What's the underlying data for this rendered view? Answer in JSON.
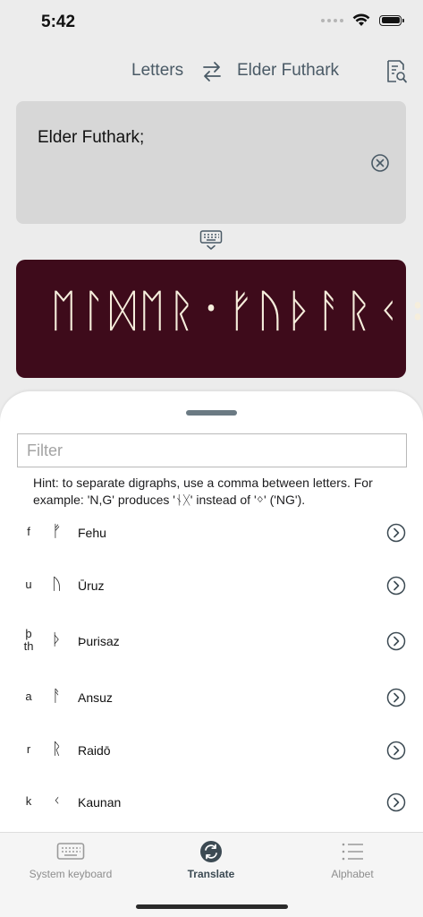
{
  "status": {
    "time": "5:42"
  },
  "header": {
    "from_label": "Letters",
    "to_label": "Elder Futhark"
  },
  "input": {
    "text": "Elder Futhark;"
  },
  "output": {
    "runes": "ᛖᛚᛞᛖᚱ᛫ᚠᚢᚦᚨᚱᚲ᛬"
  },
  "sheet": {
    "filter_placeholder": "Filter",
    "hint": "Hint: to separate digraphs, use a comma between letters. For example: 'N,G' produces 'ᚾᚷ' instead of 'ᛜ' ('NG').",
    "letters": [
      {
        "latin": "f",
        "rune": "ᚠ",
        "name": "Fehu"
      },
      {
        "latin": "u",
        "rune": "ᚢ",
        "name": "Ūruz"
      },
      {
        "latin": "þ\nth",
        "rune": "ᚦ",
        "name": "Þurisaz"
      },
      {
        "latin": "a",
        "rune": "ᚨ",
        "name": "Ansuz"
      },
      {
        "latin": "r",
        "rune": "ᚱ",
        "name": "Raidō"
      },
      {
        "latin": "k",
        "rune": "ᚲ",
        "name": "Kaunan"
      }
    ]
  },
  "tabbar": {
    "tabs": [
      {
        "label": "System keyboard",
        "icon": "keyboard-icon"
      },
      {
        "label": "Translate",
        "icon": "translate-icon",
        "active": true
      },
      {
        "label": "Alphabet",
        "icon": "list-icon"
      }
    ]
  },
  "colors": {
    "output_background": "#3e0b1b",
    "output_text": "#f6eedc",
    "accent": "#3c4a53"
  }
}
